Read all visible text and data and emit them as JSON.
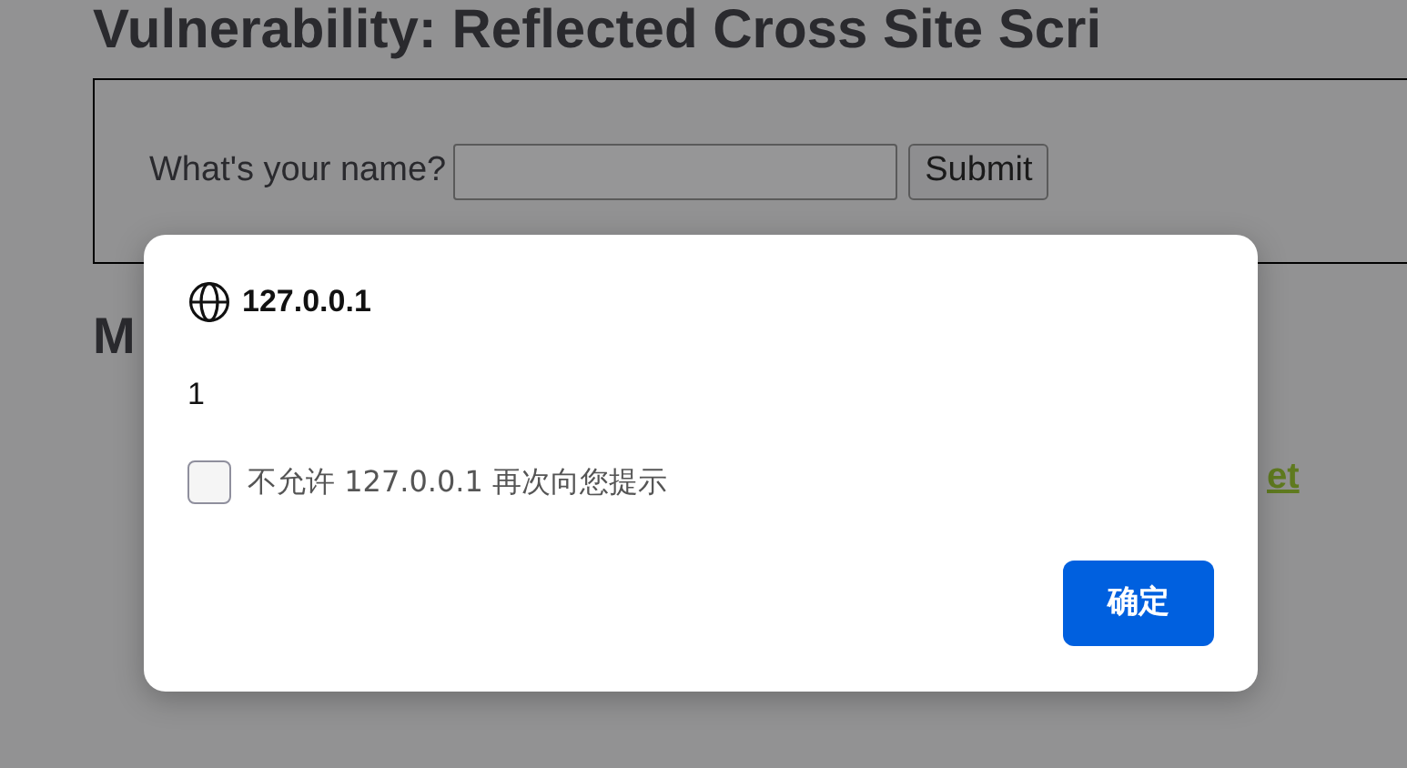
{
  "page": {
    "heading": "Vulnerability: Reflected Cross Site Scri",
    "form": {
      "label": "What's your name?",
      "submit": "Submit"
    },
    "section_heading": "M",
    "link": "et"
  },
  "dialog": {
    "origin": "127.0.0.1",
    "message": "1",
    "checkbox": {
      "label": "不允许 127.0.0.1 再次向您提示",
      "checked": false
    },
    "button": "确定"
  }
}
